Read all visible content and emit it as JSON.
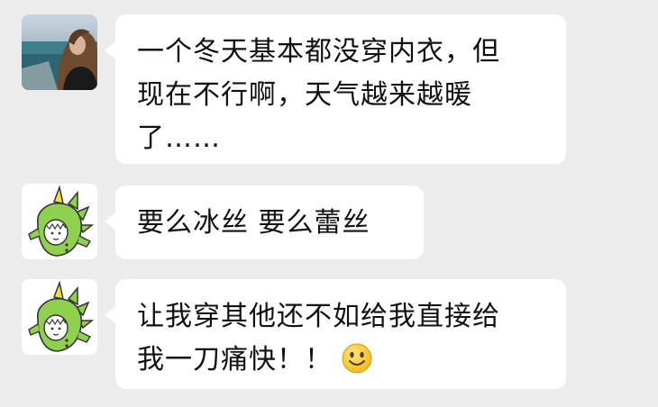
{
  "messages": [
    {
      "sender": "photo-avatar",
      "lines": [
        "一个冬天基本都没穿内衣，但",
        "现在不行啊，天气越来越暖",
        "了……"
      ]
    },
    {
      "sender": "dinosaur-avatar",
      "lines": [
        "要么冰丝 要么蕾丝"
      ]
    },
    {
      "sender": "dinosaur-avatar",
      "lines": [
        "让我穿其他还不如给我直接给",
        "我一刀痛快！！"
      ],
      "emoji": "smiling-face-emoji"
    }
  ],
  "colors": {
    "background": "#ececec",
    "bubble": "#ffffff",
    "text": "#111111",
    "dino_green": "#8fd14f",
    "dino_spike": "#f2e13a"
  }
}
